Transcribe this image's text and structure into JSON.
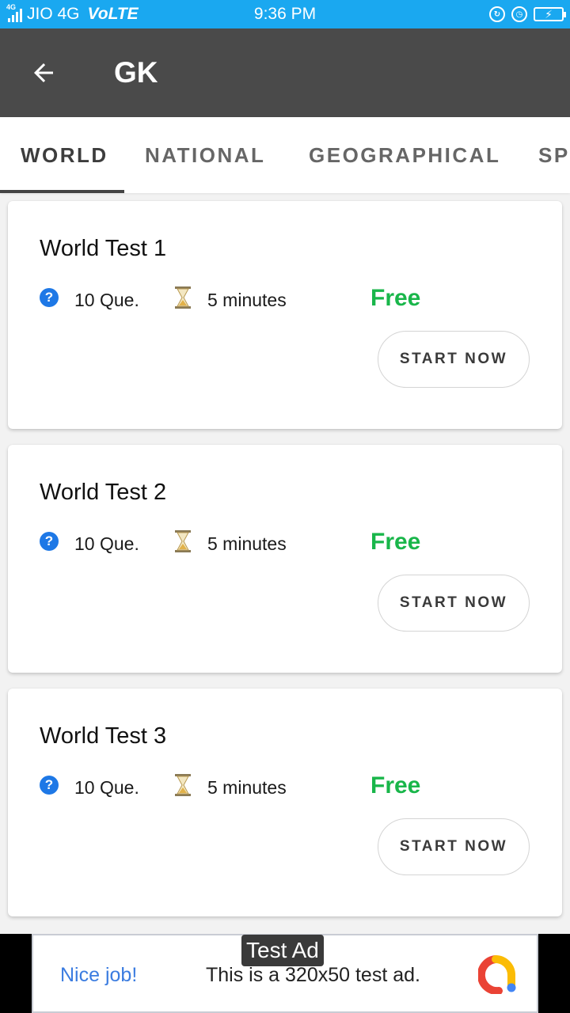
{
  "status_bar": {
    "network_small": "4G",
    "carrier": "JIO 4G",
    "volte": "VoLTE",
    "time": "9:36 PM",
    "icons": [
      "signal-icon",
      "lock-rotation-icon",
      "alarm-icon",
      "battery-charging-icon"
    ]
  },
  "app_bar": {
    "back_icon": "arrow-left-icon",
    "title": "GK"
  },
  "tabs": [
    {
      "label": "WORLD",
      "active": true
    },
    {
      "label": "NATIONAL",
      "active": false
    },
    {
      "label": "GEOGRAPHICAL",
      "active": false
    },
    {
      "label": "SP",
      "active": false
    }
  ],
  "tests": [
    {
      "title": "World Test 1",
      "questions": "10 Que.",
      "duration": "5 minutes",
      "price": "Free",
      "action": "START NOW"
    },
    {
      "title": "World Test 2",
      "questions": "10 Que.",
      "duration": "5 minutes",
      "price": "Free",
      "action": "START NOW"
    },
    {
      "title": "World Test 3",
      "questions": "10 Que.",
      "duration": "5 minutes",
      "price": "Free",
      "action": "START NOW"
    }
  ],
  "ad": {
    "label": "Test Ad",
    "headline": "Nice job!",
    "body": "This is a 320x50 test ad."
  },
  "colors": {
    "status_bar": "#1aa8f0",
    "app_bar": "#4a4a4a",
    "free": "#19b64a",
    "question_icon": "#1e78e6",
    "ad_headline": "#3b7ce0"
  }
}
